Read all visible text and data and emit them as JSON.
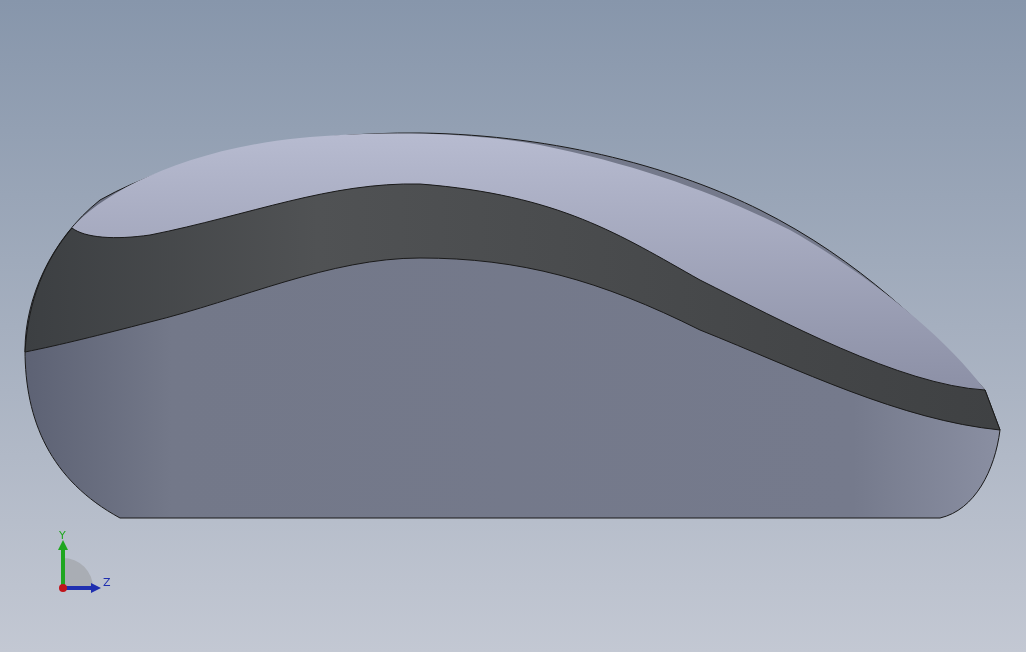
{
  "viewport": {
    "model": {
      "kind": "mouse"
    },
    "triad": {
      "axes": [
        {
          "label": "Y",
          "kind": "vertical",
          "color": "#1fa61f"
        },
        {
          "label": "Z",
          "kind": "horizontal",
          "color": "#1f2fb0"
        }
      ]
    }
  }
}
